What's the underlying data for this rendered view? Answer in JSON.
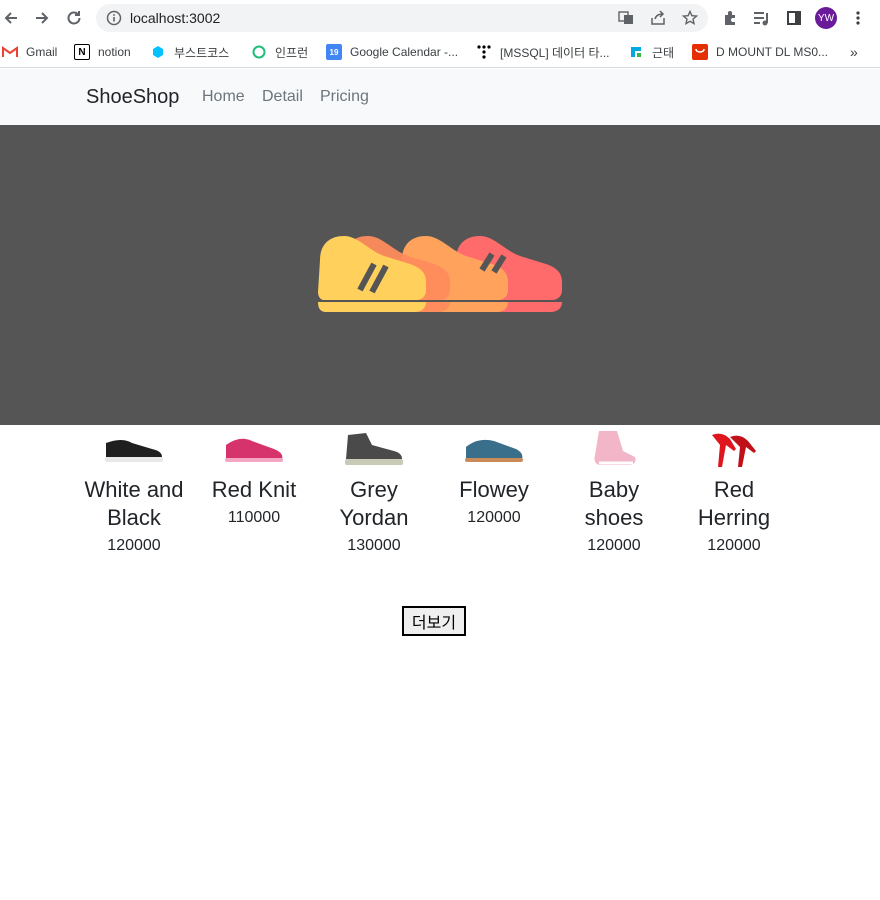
{
  "browser": {
    "url": "localhost:3002",
    "avatar_initials": "YW",
    "bookmarks": [
      {
        "label": "Gmail",
        "icon": "gmail-icon",
        "color": "#ea4335"
      },
      {
        "label": "notion",
        "icon": "notion-icon",
        "color": "#000000"
      },
      {
        "label": "부스트코스",
        "icon": "boostcourse-icon",
        "color": "#00c3ff"
      },
      {
        "label": "인프런",
        "icon": "inflearn-icon",
        "color": "#1dc078"
      },
      {
        "label": "Google Calendar -...",
        "icon": "calendar-icon",
        "color": "#4285f4"
      },
      {
        "label": "[MSSQL] 데이터 타...",
        "icon": "tistory-icon",
        "color": "#000000"
      },
      {
        "label": "근태",
        "icon": "workclock-icon",
        "color": "#00a9e0"
      },
      {
        "label": "D MOUNT DL MS0...",
        "icon": "aliexpress-icon",
        "color": "#e62e04"
      }
    ],
    "overflow_label": "»"
  },
  "app": {
    "brand": "ShoeShop",
    "nav": [
      "Home",
      "Detail",
      "Pricing"
    ],
    "hero_colors": [
      "#ffd15c",
      "#ffa35c",
      "#ff6b6b"
    ],
    "products": [
      {
        "name": "White and Black",
        "price": "120000",
        "shoe_color": "#1f1f1f",
        "sole": "#e8e8e8"
      },
      {
        "name": "Red Knit",
        "price": "110000",
        "shoe_color": "#d6336c",
        "sole": "#f3a5c2"
      },
      {
        "name": "Grey Yordan",
        "price": "130000",
        "shoe_color": "#4a4a4a",
        "sole": "#c9c9b8"
      },
      {
        "name": "Flowey",
        "price": "120000",
        "shoe_color": "#3a6f8c",
        "sole": "#c98b5a"
      },
      {
        "name": "Baby shoes",
        "price": "120000",
        "shoe_color": "#f3b5c8",
        "sole": "#ffffff"
      },
      {
        "name": "Red Herring",
        "price": "120000",
        "shoe_color": "#e0161e",
        "sole": "#b00010"
      }
    ],
    "more_button": "더보기"
  }
}
